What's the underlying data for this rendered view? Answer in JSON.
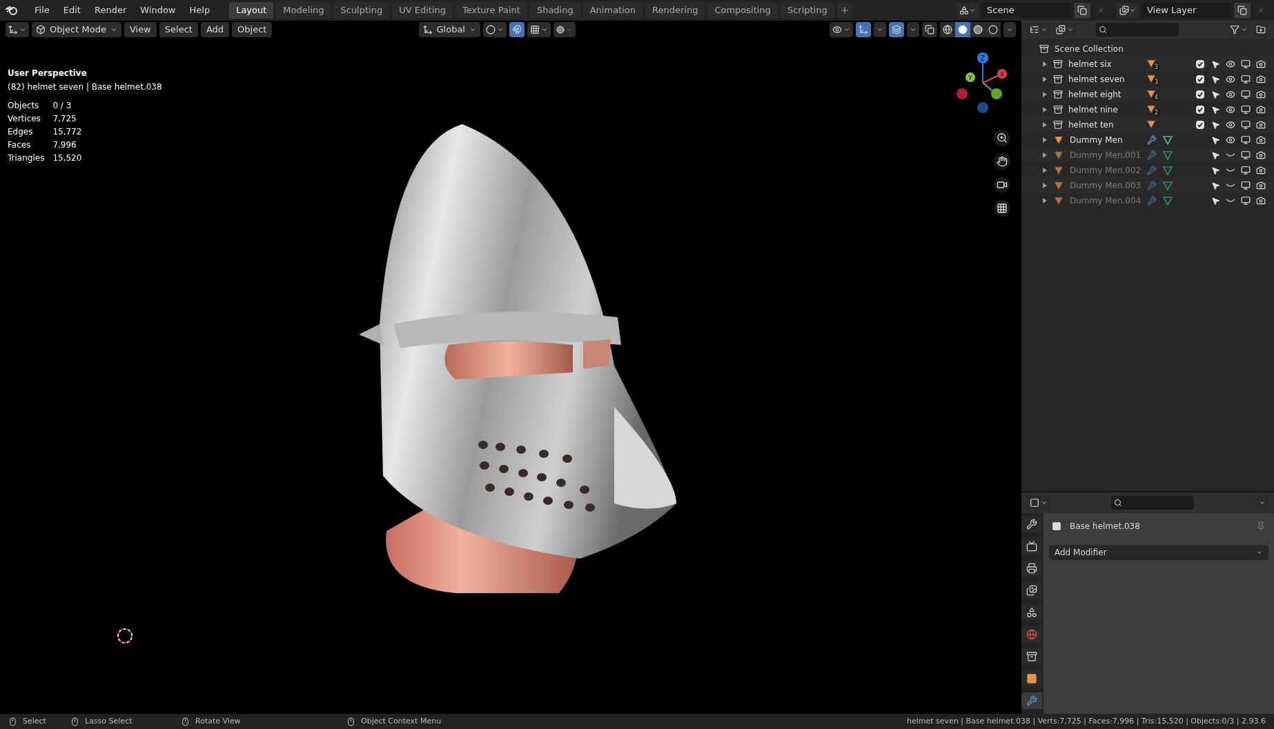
{
  "menu": [
    "File",
    "Edit",
    "Render",
    "Window",
    "Help"
  ],
  "workspaces": [
    {
      "label": "Layout",
      "selected": true
    },
    {
      "label": "Modeling",
      "selected": false
    },
    {
      "label": "Sculpting",
      "selected": false
    },
    {
      "label": "UV Editing",
      "selected": false
    },
    {
      "label": "Texture Paint",
      "selected": false
    },
    {
      "label": "Shading",
      "selected": false
    },
    {
      "label": "Animation",
      "selected": false
    },
    {
      "label": "Rendering",
      "selected": false
    },
    {
      "label": "Compositing",
      "selected": false
    },
    {
      "label": "Scripting",
      "selected": false
    }
  ],
  "scene": "Scene",
  "view_layer": "View Layer",
  "header": {
    "mode": "Object Mode",
    "menus": [
      "View",
      "Select",
      "Add",
      "Object"
    ],
    "orientation": "Global",
    "snap_on": true,
    "gizmos_on": true,
    "overlays_on": true,
    "shading": [
      {
        "kind": "wireframe",
        "selected": false
      },
      {
        "kind": "solid",
        "selected": true
      },
      {
        "kind": "material",
        "selected": false
      },
      {
        "kind": "rendered",
        "selected": false
      }
    ]
  },
  "viewport": {
    "title": "User Perspective",
    "subtitle": "(82) helmet seven | Base helmet.038",
    "stats": [
      {
        "label": "Objects",
        "value": "0 / 3"
      },
      {
        "label": "Vertices",
        "value": "7,725"
      },
      {
        "label": "Edges",
        "value": "15,772"
      },
      {
        "label": "Faces",
        "value": "7,996"
      },
      {
        "label": "Triangles",
        "value": "15,520"
      }
    ],
    "gizmo": [
      "Z",
      "Y",
      "X"
    ]
  },
  "outliner": {
    "root": "Scene Collection",
    "items": [
      {
        "kind": "collection",
        "name": "helmet six",
        "count": "3",
        "expanded": false,
        "checked": true,
        "visible": true
      },
      {
        "kind": "collection",
        "name": "helmet seven",
        "count": "3",
        "expanded": false,
        "checked": true,
        "visible": true
      },
      {
        "kind": "collection",
        "name": "helmet eight",
        "count": "4",
        "expanded": false,
        "checked": true,
        "visible": true
      },
      {
        "kind": "collection",
        "name": "helmet nine",
        "count": "2",
        "expanded": false,
        "checked": true,
        "visible": true
      },
      {
        "kind": "collection",
        "name": "helmet ten",
        "expanded": false,
        "checked": true,
        "visible": true
      },
      {
        "kind": "object",
        "name": "Dummy Men",
        "expanded": false,
        "visible": true
      },
      {
        "kind": "object",
        "name": "Dummy Men.001",
        "expanded": false,
        "visible": false
      },
      {
        "kind": "object",
        "name": "Dummy Men.002",
        "expanded": false,
        "visible": false
      },
      {
        "kind": "object",
        "name": "Dummy Men.003",
        "expanded": false,
        "visible": false
      },
      {
        "kind": "object",
        "name": "Dummy Men.004",
        "expanded": false,
        "visible": false
      }
    ]
  },
  "properties": {
    "object_name": "Base helmet.038",
    "add_modifier": "Add Modifier",
    "tabs": [
      {
        "kind": "tool",
        "selected": false
      },
      {
        "kind": "render",
        "selected": false
      },
      {
        "kind": "output",
        "selected": false
      },
      {
        "kind": "view_layer",
        "selected": false
      },
      {
        "kind": "scene",
        "selected": false
      },
      {
        "kind": "world",
        "selected": false
      },
      {
        "kind": "collection",
        "selected": false
      },
      {
        "kind": "object",
        "selected": false
      },
      {
        "kind": "modifiers",
        "selected": true
      }
    ]
  },
  "status_bar": {
    "hints": [
      "Select",
      "Lasso Select",
      "Rotate View",
      "Object Context Menu"
    ],
    "stats": "helmet seven | Base helmet.038 | Verts:7,725 | Faces:7,996 | Tris:15,520 | Objects:0/3 | 2.93.6"
  }
}
